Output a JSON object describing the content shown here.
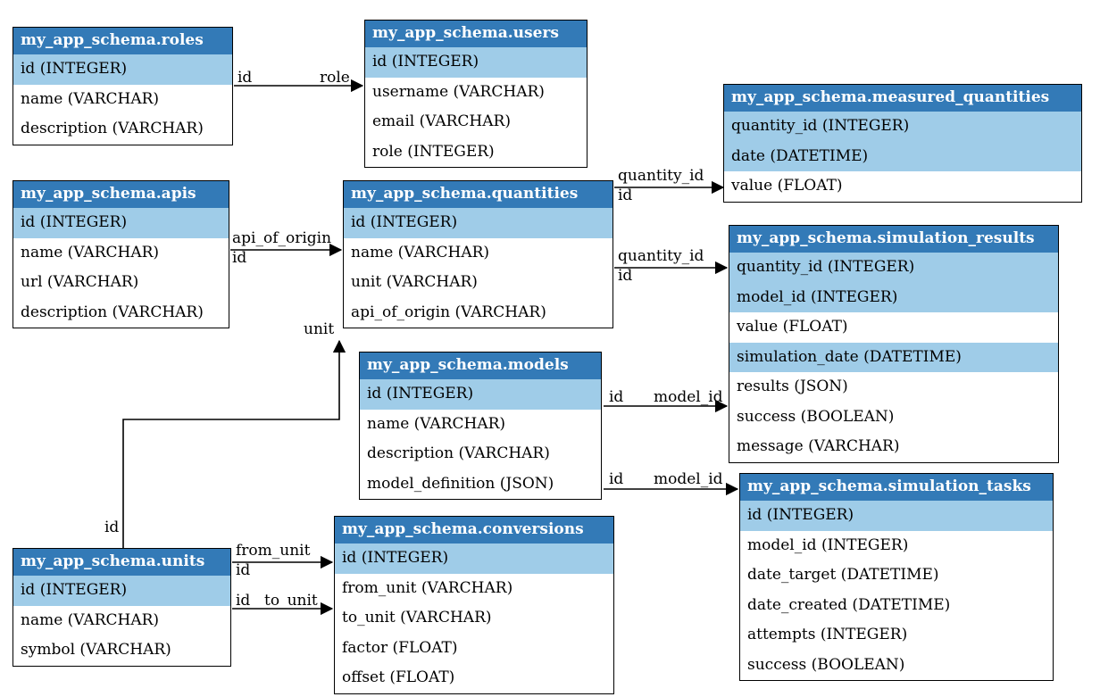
{
  "diagram": {
    "schema_prefix": "my_app_schema",
    "colors": {
      "header_bg": "#337ab7",
      "header_fg": "#ffffff",
      "pk_bg": "#9fcce8",
      "border": "#000000"
    },
    "tables": {
      "roles": {
        "title": "my_app_schema.roles",
        "columns": [
          {
            "text": "id (INTEGER)",
            "pk": true
          },
          {
            "text": "name (VARCHAR)",
            "pk": false
          },
          {
            "text": "description (VARCHAR)",
            "pk": false
          }
        ]
      },
      "users": {
        "title": "my_app_schema.users",
        "columns": [
          {
            "text": "id (INTEGER)",
            "pk": true
          },
          {
            "text": "username (VARCHAR)",
            "pk": false
          },
          {
            "text": "email (VARCHAR)",
            "pk": false
          },
          {
            "text": "role (INTEGER)",
            "pk": false
          }
        ]
      },
      "measured_quantities": {
        "title": "my_app_schema.measured_quantities",
        "columns": [
          {
            "text": "quantity_id (INTEGER)",
            "pk": true
          },
          {
            "text": "date (DATETIME)",
            "pk": true
          },
          {
            "text": "value (FLOAT)",
            "pk": false
          }
        ]
      },
      "apis": {
        "title": "my_app_schema.apis",
        "columns": [
          {
            "text": "id (INTEGER)",
            "pk": true
          },
          {
            "text": "name (VARCHAR)",
            "pk": false
          },
          {
            "text": "url (VARCHAR)",
            "pk": false
          },
          {
            "text": "description (VARCHAR)",
            "pk": false
          }
        ]
      },
      "quantities": {
        "title": "my_app_schema.quantities",
        "columns": [
          {
            "text": "id (INTEGER)",
            "pk": true
          },
          {
            "text": "name (VARCHAR)",
            "pk": false
          },
          {
            "text": "unit (VARCHAR)",
            "pk": false
          },
          {
            "text": "api_of_origin (VARCHAR)",
            "pk": false
          }
        ]
      },
      "simulation_results": {
        "title": "my_app_schema.simulation_results",
        "columns": [
          {
            "text": "quantity_id (INTEGER)",
            "pk": true
          },
          {
            "text": "model_id (INTEGER)",
            "pk": true
          },
          {
            "text": "value (FLOAT)",
            "pk": false
          },
          {
            "text": "simulation_date (DATETIME)",
            "pk": true
          },
          {
            "text": "results (JSON)",
            "pk": false
          },
          {
            "text": "success (BOOLEAN)",
            "pk": false
          },
          {
            "text": "message (VARCHAR)",
            "pk": false
          }
        ]
      },
      "models": {
        "title": "my_app_schema.models",
        "columns": [
          {
            "text": "id (INTEGER)",
            "pk": true
          },
          {
            "text": "name (VARCHAR)",
            "pk": false
          },
          {
            "text": "description (VARCHAR)",
            "pk": false
          },
          {
            "text": "model_definition (JSON)",
            "pk": false
          }
        ]
      },
      "simulation_tasks": {
        "title": "my_app_schema.simulation_tasks",
        "columns": [
          {
            "text": "id (INTEGER)",
            "pk": true
          },
          {
            "text": "model_id (INTEGER)",
            "pk": false
          },
          {
            "text": "date_target (DATETIME)",
            "pk": false
          },
          {
            "text": "date_created (DATETIME)",
            "pk": false
          },
          {
            "text": "attempts (INTEGER)",
            "pk": false
          },
          {
            "text": "success (BOOLEAN)",
            "pk": false
          }
        ]
      },
      "units": {
        "title": "my_app_schema.units",
        "columns": [
          {
            "text": "id (INTEGER)",
            "pk": true
          },
          {
            "text": "name (VARCHAR)",
            "pk": false
          },
          {
            "text": "symbol (VARCHAR)",
            "pk": false
          }
        ]
      },
      "conversions": {
        "title": "my_app_schema.conversions",
        "columns": [
          {
            "text": "id (INTEGER)",
            "pk": true
          },
          {
            "text": "from_unit (VARCHAR)",
            "pk": false
          },
          {
            "text": "to_unit (VARCHAR)",
            "pk": false
          },
          {
            "text": "factor (FLOAT)",
            "pk": false
          },
          {
            "text": "offset (FLOAT)",
            "pk": false
          }
        ]
      }
    },
    "edges": [
      {
        "from_label": "id",
        "to_label": "role",
        "desc": "roles.id -> users.role"
      },
      {
        "from_label": "api_of_origin",
        "to_label": "id",
        "desc": "quantities.api_of_origin -> apis ... arrow to quantities"
      },
      {
        "from_label": "quantity_id",
        "to_label": "id",
        "desc": "measured_quantities.quantity_id -> quantities.id"
      },
      {
        "from_label": "quantity_id",
        "to_label": "id",
        "desc": "simulation_results.quantity_id -> quantities.id"
      },
      {
        "from_label": "id",
        "to_label": "model_id",
        "desc": "models.id -> simulation_results.model_id"
      },
      {
        "from_label": "id",
        "to_label": "model_id",
        "desc": "models.id -> simulation_tasks.model_id"
      },
      {
        "from_label": "unit",
        "to_label": "",
        "desc": "quantities.unit (arrow head near quantities)"
      },
      {
        "from_label": "id",
        "to_label": "",
        "desc": "units.id upward"
      },
      {
        "from_label": "from_unit",
        "to_label": "id",
        "desc": "conversions.from_unit -> units.id"
      },
      {
        "from_label": "id",
        "to_label": "to_unit",
        "desc": "units.id -> conversions.to_unit"
      }
    ]
  },
  "labels": {
    "e0_from": "id",
    "e0_to": "role",
    "e1_top": "api_of_origin",
    "e1_bot": "id",
    "e2_top": "quantity_id",
    "e2_bot": "id",
    "e3_top": "quantity_id",
    "e3_bot": "id",
    "e4_from": "id",
    "e4_to": "model_id",
    "e5_from": "id",
    "e5_to": "model_id",
    "e6": "unit",
    "e7": "id",
    "e8_top": "from_unit",
    "e8_bot": "id",
    "e9_from": "id",
    "e9_to": "to_unit"
  }
}
